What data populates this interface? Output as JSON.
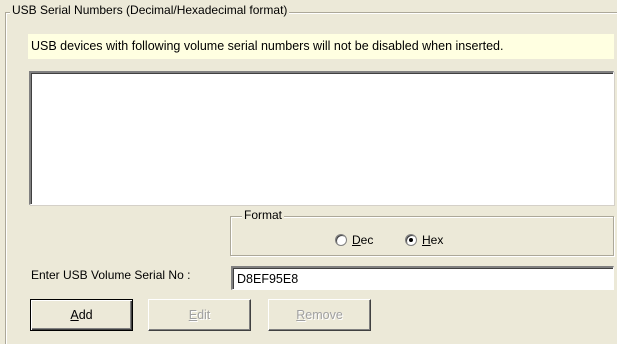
{
  "group": {
    "title": "USB Serial Numbers (Decimal/Hexadecimal format)"
  },
  "info": {
    "text": "USB devices with following volume serial numbers will not be disabled when inserted."
  },
  "serial_list": {
    "items": []
  },
  "format": {
    "title": "Format",
    "options": [
      {
        "label": "Dec",
        "selected": false
      },
      {
        "label": "Hex",
        "selected": true
      }
    ]
  },
  "serial_entry": {
    "label": "Enter USB Volume Serial No :",
    "value": "D8EF95E8"
  },
  "buttons": {
    "add": {
      "label": "Add",
      "enabled": true
    },
    "edit": {
      "label": "Edit",
      "enabled": false
    },
    "remove": {
      "label": "Remove",
      "enabled": false
    }
  },
  "colors": {
    "panel": "#ece9d8",
    "info_background": "#ffffe1",
    "disabled_text": "#a0a0a0"
  }
}
